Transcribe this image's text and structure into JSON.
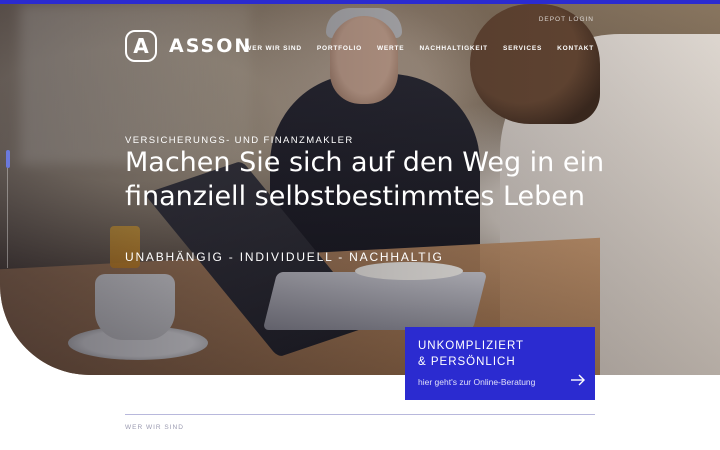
{
  "brand": {
    "logo_letter": "A",
    "name": "ASSON"
  },
  "header": {
    "depot_login": "DEPOT LOGIN",
    "nav": [
      "WER WIR SIND",
      "PORTFOLIO",
      "WERTE",
      "NACHHALTIGKEIT",
      "SERVICES",
      "KONTAKT"
    ]
  },
  "hero": {
    "eyebrow": "VERSICHERUNGS- UND FINANZMAKLER",
    "headline_line1": "Machen Sie sich auf den Weg in ein",
    "headline_line2": "finanziell selbstbestimmtes Leben",
    "tagline": "UNABHÄNGIG - INDIVIDUELL - NACHHALTIG"
  },
  "cta": {
    "title_line1": "UNKOMPLIZIERT",
    "title_line2": "& PERSÖNLICH",
    "link_text": "hier geht's zur Online-Beratung",
    "icon": "arrow-right-icon"
  },
  "section": {
    "label": "WER WIR SIND"
  },
  "colors": {
    "accent": "#2b2bd0",
    "text_light": "#ffffff",
    "muted": "#9a9ab0"
  }
}
